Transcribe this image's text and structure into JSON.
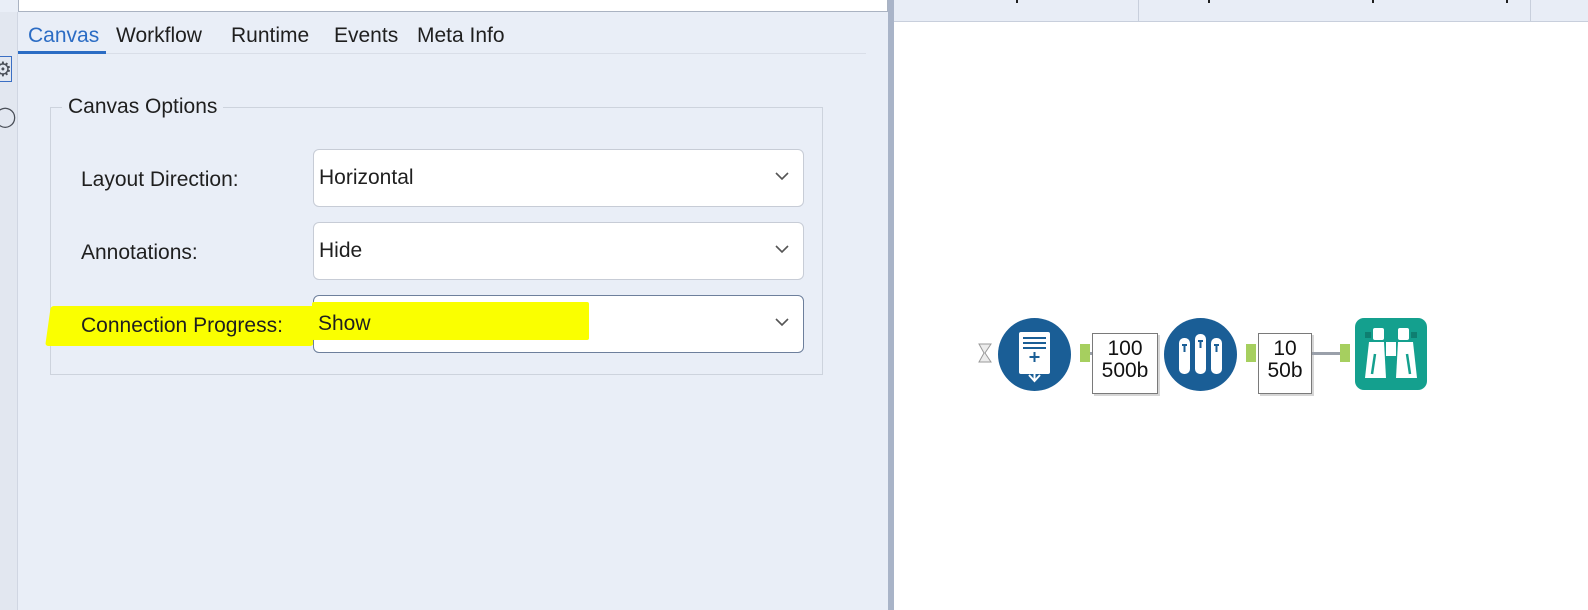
{
  "tabs": [
    {
      "label": "Canvas",
      "active": true
    },
    {
      "label": "Workflow",
      "active": false
    },
    {
      "label": "Runtime",
      "active": false
    },
    {
      "label": "Events",
      "active": false
    },
    {
      "label": "Meta Info",
      "active": false
    }
  ],
  "canvas_options": {
    "title": "Canvas Options",
    "fields": [
      {
        "label": "Layout Direction:",
        "value": "Horizontal"
      },
      {
        "label": "Annotations:",
        "value": "Hide"
      },
      {
        "label": "Connection Progress:",
        "value": "Show"
      }
    ]
  },
  "highlight_color": "#faff00",
  "accent_color": "#2b6cc4",
  "workflow": {
    "tools": [
      {
        "name": "input-data-tool",
        "icon": "input-data-icon",
        "color": "#1a5e96"
      },
      {
        "name": "sample-tool",
        "icon": "test-tubes-icon",
        "color": "#1a5e96"
      },
      {
        "name": "browse-tool",
        "icon": "binoculars-icon",
        "color": "#14a08e"
      }
    ],
    "connections": [
      {
        "records": "100",
        "size": "500b"
      },
      {
        "records": "10",
        "size": "50b"
      }
    ]
  }
}
